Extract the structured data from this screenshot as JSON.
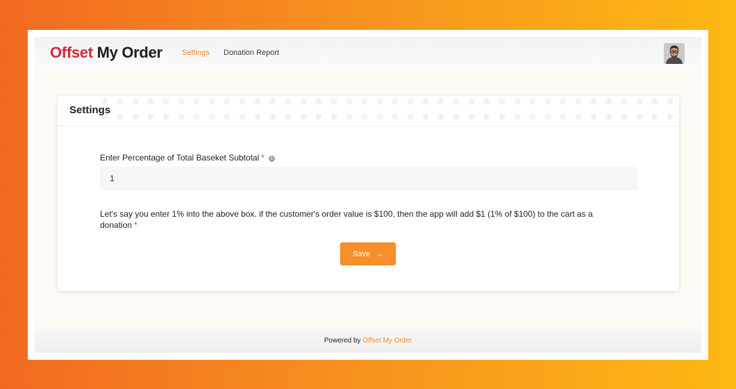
{
  "header": {
    "logo_part1": "Offset",
    "logo_part2": "My Order",
    "nav": {
      "settings": "Settings",
      "donation_report": "Donation Report"
    }
  },
  "settings_card": {
    "title": "Settings",
    "field_label": "Enter Percentage of Total Baseket Subtotal",
    "required_mark": "*",
    "info_glyph": "i",
    "field_value": "1",
    "help_text": "Let's say you enter 1% into the above box. if the customer's order value is $100, then the app will add $1 (1% of $100) to the cart as a donation",
    "save_label": "Save",
    "save_arrow": "→"
  },
  "footer": {
    "prefix": "Powered by",
    "link": "Offset My Order"
  },
  "colors": {
    "brand_red": "#d42a3c",
    "accent_orange": "#f7902c",
    "background_gradient_start": "#f26a22",
    "background_gradient_end": "#fdb913"
  },
  "icons": {
    "avatar": "user-avatar-icon",
    "info": "info-icon",
    "arrow": "arrow-right-icon"
  }
}
